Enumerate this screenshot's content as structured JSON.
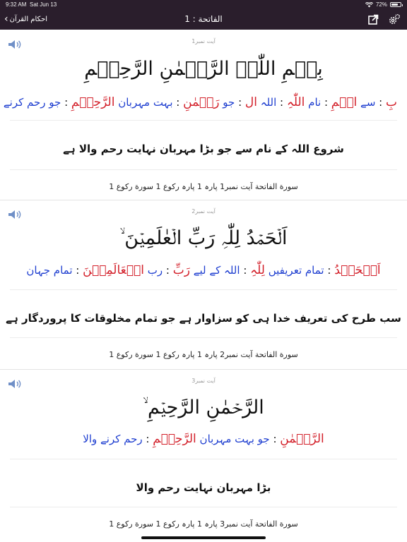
{
  "status_bar": {
    "time": "9:32 AM",
    "date": "Sat Jun 13",
    "battery_percent": "72%",
    "battery_level": 0.72
  },
  "nav": {
    "back_label": "احکام القرآن",
    "title": "الفاتحة : 1",
    "share_icon": "share-icon",
    "settings_icon": "gear-icon"
  },
  "verses": [
    {
      "ayah_label": "آیت نمبر1",
      "arabic": "بِسۡمِ اللّٰہِ الرَّحۡمٰنِ الرَّحِیۡمِ",
      "words": [
        {
          "ar": "بِ",
          "ur": "سے"
        },
        {
          "ar": "اسۡمِ",
          "ur": "نام"
        },
        {
          "ar": "اللّٰہِ",
          "ur": "اللہ"
        },
        {
          "ar": "ال",
          "ur": "جو"
        },
        {
          "ar": "رَحۡمٰنِ",
          "ur": "بہت مہربان"
        },
        {
          "ar": "الرَّحِیۡمِ",
          "ur": "جو رحم کرنے والا"
        }
      ],
      "translation": "شروع اللہ کے نام سے جو بڑا مہربان نہایت رحم والا ہے",
      "reference": "سورة الفاتحة آیت نمبر1 پارہ 1 پارہ رکوع 1 سورة رکوع 1"
    },
    {
      "ayah_label": "آیت نمبر2",
      "arabic": "اَلۡحَمۡدُ لِلّٰہِ رَبِّ الۡعٰلَمِیۡنَ ۙ",
      "words": [
        {
          "ar": "اَلۡحَمۡدُ",
          "ur": "تمام تعریفیں"
        },
        {
          "ar": "لِلّٰہِ",
          "ur": "اللہ کے لیے"
        },
        {
          "ar": "رَبِّ",
          "ur": "رب"
        },
        {
          "ar": "الۡعَالَمِیۡنَ",
          "ur": "تمام جہان"
        }
      ],
      "translation": "سب طرح کی تعریف خدا ہی کو سزاوار ہے جو تمام مخلوقات کا پروردگار ہے",
      "reference": "سورة الفاتحة آیت نمبر2 پارہ 1 پارہ رکوع 1 سورة رکوع 1"
    },
    {
      "ayah_label": "آیت نمبر3",
      "arabic": "الرَّحۡمٰنِ الرَّحِیۡمِ ۙ",
      "words": [
        {
          "ar": "الرَّحۡمٰنِ",
          "ur": "جو بہت مہربان"
        },
        {
          "ar": "الرَّحِیۡمِ",
          "ur": "رحم کرنے والا"
        }
      ],
      "translation": "بڑا مہربان نہایت رحم والا",
      "reference": "سورة الفاتحة آیت نمبر3 پارہ 1 پارہ رکوع 1 سورة رکوع 1"
    }
  ]
}
